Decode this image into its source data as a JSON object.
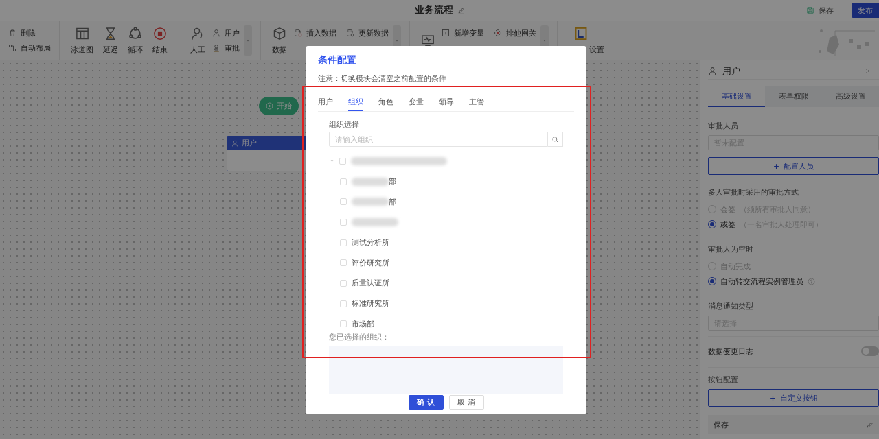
{
  "header": {
    "title": "业务流程",
    "actions": [
      {
        "kind": "link",
        "label": "保存"
      },
      {
        "kind": "primary",
        "label": "发布"
      }
    ]
  },
  "toolbar": {
    "groups": [
      {
        "items": [
          {
            "kind": "small",
            "label": "删除"
          },
          {
            "kind": "small",
            "label": "自动布局"
          }
        ],
        "dropdown": false
      },
      {
        "items": [
          {
            "kind": "big",
            "label": "泳道图"
          },
          {
            "kind": "big",
            "label": "延迟"
          },
          {
            "kind": "big",
            "label": "循环"
          },
          {
            "kind": "big",
            "label": "结束"
          }
        ],
        "dropdown": false
      },
      {
        "items": [
          {
            "kind": "big",
            "label": "人工"
          },
          {
            "kind": "small",
            "label": "用户"
          },
          {
            "kind": "small",
            "label": "审批"
          }
        ],
        "dropdown": true
      },
      {
        "items": [
          {
            "kind": "big",
            "label": "数据"
          },
          {
            "kind": "small",
            "label": "插入数据"
          },
          {
            "kind": "small",
            "label": "更新数据"
          }
        ],
        "dropdown": true
      },
      {
        "items": [
          {
            "kind": "big"
          },
          {
            "kind": "small",
            "label": "新增变量"
          },
          {
            "kind": "small",
            "label": "排他网关"
          }
        ],
        "dropdown": true
      },
      {
        "items": [
          {
            "kind": "big",
            "label": "设置"
          }
        ],
        "dropdown": false
      }
    ]
  },
  "canvas": {
    "nodes": [
      {
        "kind": "start",
        "label": "开始"
      },
      {
        "kind": "task",
        "label": "用户"
      }
    ]
  },
  "panel": {
    "title": "用户",
    "tabs": [
      {
        "label": "基础设置",
        "selected": true
      },
      {
        "label": "表单权限",
        "selected": false
      },
      {
        "label": "高级设置",
        "selected": false
      }
    ],
    "sections": [
      {
        "kind": "field",
        "label": "审批人员",
        "placeholder": "暂未配置",
        "button": "配置人员"
      },
      {
        "kind": "radios",
        "label": "多人审批时采用的审批方式",
        "options": [
          {
            "label": "会签",
            "hint": "（须所有审批人同意）",
            "selected": false,
            "help": false
          },
          {
            "label": "或签",
            "hint": "（一名审批人处理即可）",
            "selected": true,
            "help": false
          }
        ]
      },
      {
        "kind": "radios",
        "label": "审批人为空时",
        "options": [
          {
            "label": "自动完成",
            "selected": false,
            "help": false
          },
          {
            "label": "自动转交流程实例管理员",
            "selected": true,
            "help": true
          }
        ]
      },
      {
        "kind": "select",
        "label": "消息通知类型",
        "placeholder": "请选择"
      },
      {
        "kind": "switch",
        "label": "数据变更日志",
        "on": false
      },
      {
        "kind": "buttons",
        "label": "按钮配置",
        "button": "自定义按钮",
        "items": [
          {
            "label": "保存"
          }
        ]
      }
    ]
  },
  "dialog": {
    "title": "条件配置",
    "note": "注意：切换模块会清空之前配置的条件",
    "tabs": [
      {
        "label": "用户",
        "selected": false
      },
      {
        "label": "组织",
        "selected": true
      },
      {
        "label": "角色",
        "selected": false
      },
      {
        "label": "变量",
        "selected": false
      },
      {
        "label": "领导",
        "selected": false
      },
      {
        "label": "主管",
        "selected": false
      }
    ],
    "search_label": "组织选择",
    "search": {
      "placeholder": "请输入组织"
    },
    "tree": [
      {
        "redacted": true,
        "checked": false,
        "expanded": true,
        "children": [
          {
            "redacted": true,
            "label": "部",
            "checked": false
          },
          {
            "redacted": true,
            "label": "部",
            "checked": false
          },
          {
            "redacted": true,
            "checked": false
          },
          {
            "redacted": false,
            "label": "测试分析所",
            "checked": false
          },
          {
            "redacted": false,
            "label": "评价研究所",
            "checked": false
          },
          {
            "redacted": false,
            "label": "质量认证所",
            "checked": false
          },
          {
            "redacted": false,
            "label": "标准研究所",
            "checked": false
          },
          {
            "redacted": false,
            "label": "市场部",
            "checked": false
          }
        ]
      }
    ],
    "selected_label": "您已选择的组织：",
    "buttons": [
      {
        "kind": "primary",
        "label": "确 认"
      },
      {
        "kind": "default",
        "label": "取 消"
      }
    ]
  }
}
